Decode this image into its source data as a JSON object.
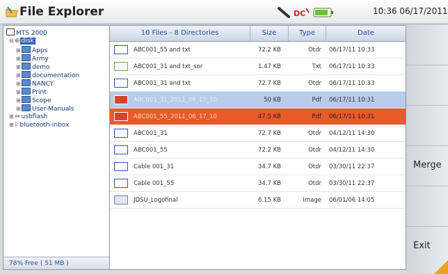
{
  "window": {
    "title": "File Explorer",
    "time": "10:36  06/17/2011"
  },
  "tree": {
    "root": "MTS 2000",
    "selected": "disk",
    "items": [
      {
        "label": "Apps"
      },
      {
        "label": "Army"
      },
      {
        "label": "demo"
      },
      {
        "label": "documentation"
      },
      {
        "label": "NANCY"
      },
      {
        "label": "Print"
      },
      {
        "label": "Scope"
      },
      {
        "label": "User-Manuals"
      }
    ],
    "usb": "usbflash",
    "bluetooth": "bluetooth-inbox",
    "free_space": "78% Free (  51 MB )"
  },
  "table": {
    "headers": {
      "name": "10 Files - 8 Directories",
      "size": "Size",
      "type": "Type",
      "date": "Date"
    },
    "rows": [
      {
        "name": "ABC001_55 and txt",
        "size": "72.2 KB",
        "type": "Otdr",
        "date": "06/17/11 10:33",
        "icon": "otdr",
        "state": ""
      },
      {
        "name": "ABC001_31 and txt_sor",
        "size": "1.47 KB",
        "type": "Txt",
        "date": "06/17/11 10:33",
        "icon": "sor",
        "state": ""
      },
      {
        "name": "ABC001_31 and txt",
        "size": "72.7 KB",
        "type": "Otdr",
        "date": "06/17/11 10:33",
        "icon": "otdr",
        "state": ""
      },
      {
        "name": "ABC001_31_2011_06_17_10",
        "size": "50 KB",
        "type": "Pdf",
        "date": "06/17/11 10:31",
        "icon": "pdf",
        "state": "sel-blue"
      },
      {
        "name": "ABC001_55_2011_06_17_10",
        "size": "47.5 KB",
        "type": "Pdf",
        "date": "06/17/11 10:31",
        "icon": "pdf",
        "state": "sel-red"
      },
      {
        "name": "ABC001_31",
        "size": "72.7 KB",
        "type": "Otdr",
        "date": "04/12/11 14:30",
        "icon": "otdr",
        "state": ""
      },
      {
        "name": "ABC001_55",
        "size": "72.2 KB",
        "type": "Otdr",
        "date": "04/12/11 14:30",
        "icon": "otdr",
        "state": ""
      },
      {
        "name": "Cable 001_31",
        "size": "34.7 KB",
        "type": "Otdr",
        "date": "03/30/11 22:37",
        "icon": "otdr",
        "state": ""
      },
      {
        "name": "Cable 001_55",
        "size": "34.7 KB",
        "type": "Otdr",
        "date": "03/30/11 22:37",
        "icon": "otdr",
        "state": ""
      },
      {
        "name": "JDSU_Logofinal",
        "size": "6.15 KB",
        "type": "Image",
        "date": "06/01/06 14:05",
        "icon": "img",
        "state": ""
      }
    ]
  },
  "side_buttons": {
    "merge": "Merge",
    "exit": "Exit"
  },
  "colors": {
    "accent_blue": "#2d5db0",
    "selection_blue": "#b8cbe8",
    "selection_red": "#e85a2a",
    "header_text": "#1f4fa0"
  }
}
